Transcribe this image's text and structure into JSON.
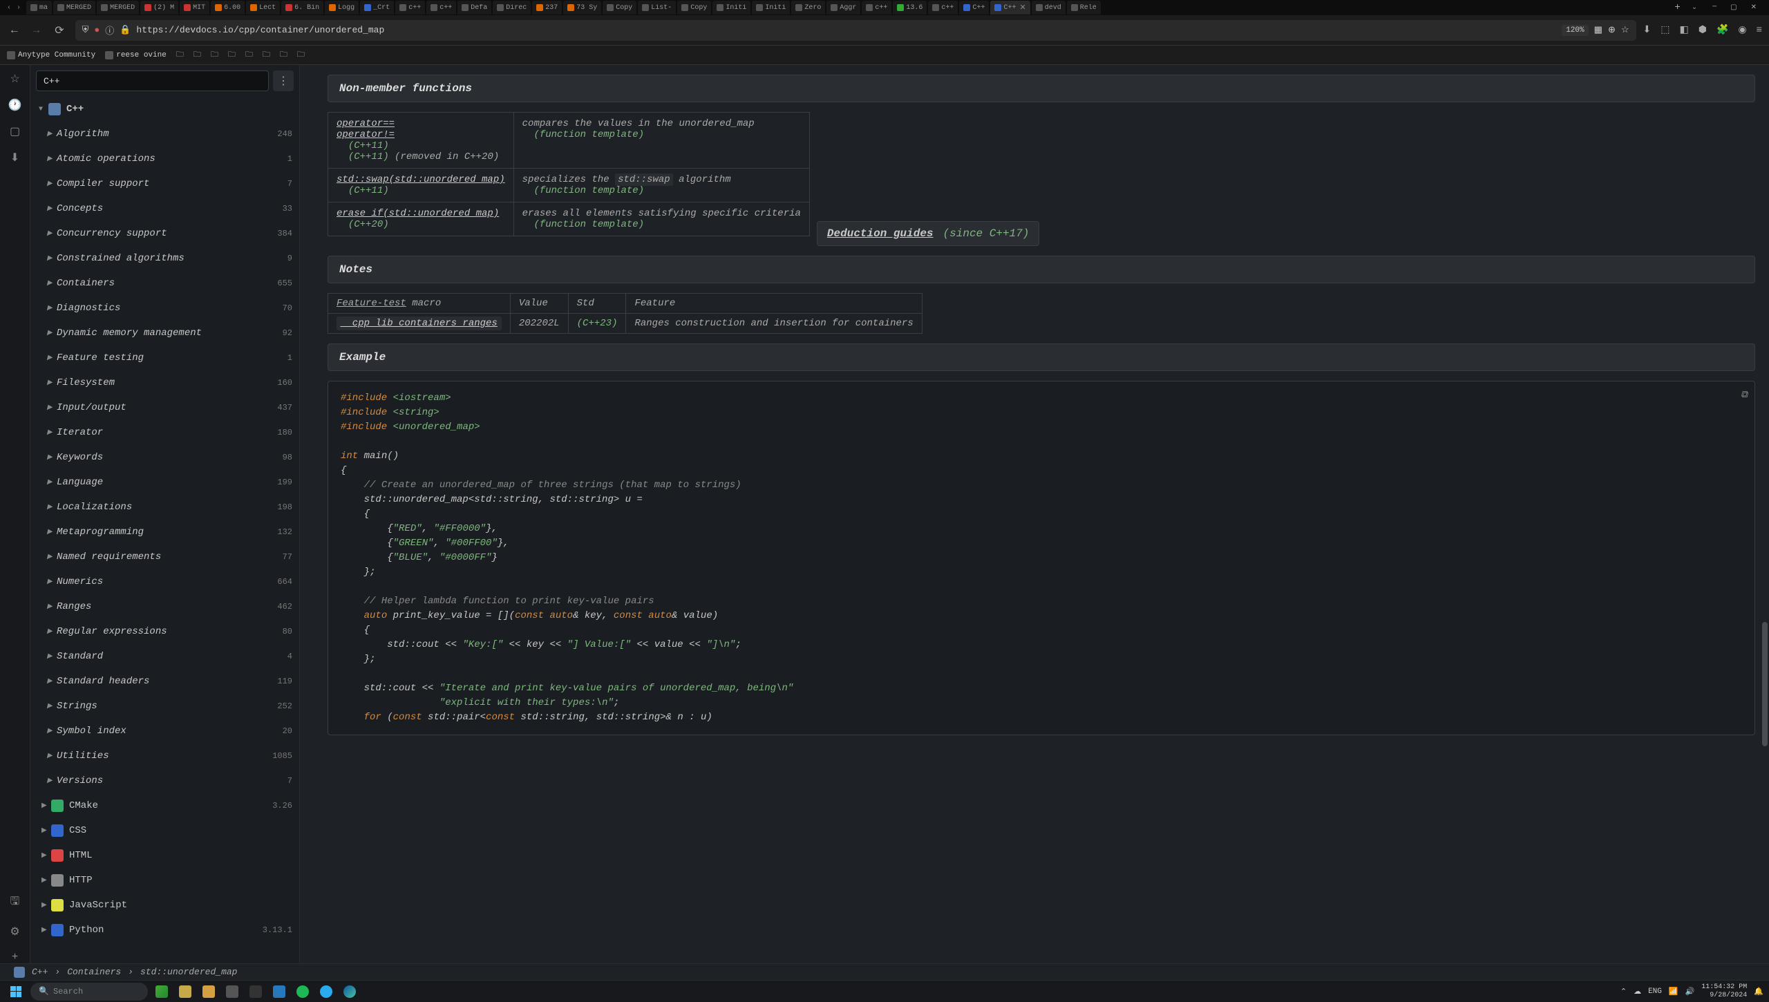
{
  "browser": {
    "tabs": [
      {
        "label": "ma",
        "icon": ""
      },
      {
        "label": "MERGED",
        "icon": ""
      },
      {
        "label": "MERGED",
        "icon": ""
      },
      {
        "label": "(2) M",
        "icon": "red"
      },
      {
        "label": "MIT",
        "icon": "red"
      },
      {
        "label": "6.00",
        "icon": "orange"
      },
      {
        "label": "Lect",
        "icon": "orange"
      },
      {
        "label": "6. Bin",
        "icon": "red"
      },
      {
        "label": "Logg",
        "icon": "orange"
      },
      {
        "label": "_Crt",
        "icon": "blue"
      },
      {
        "label": "c++",
        "icon": ""
      },
      {
        "label": "c++",
        "icon": ""
      },
      {
        "label": "Defa",
        "icon": ""
      },
      {
        "label": "Direc",
        "icon": ""
      },
      {
        "label": "237",
        "icon": "orange"
      },
      {
        "label": "73 Sy",
        "icon": "orange"
      },
      {
        "label": "Copy",
        "icon": ""
      },
      {
        "label": "List-",
        "icon": ""
      },
      {
        "label": "Copy",
        "icon": ""
      },
      {
        "label": "Initi",
        "icon": ""
      },
      {
        "label": "Initi",
        "icon": ""
      },
      {
        "label": "Zero",
        "icon": ""
      },
      {
        "label": "Aggr",
        "icon": ""
      },
      {
        "label": "c++",
        "icon": ""
      },
      {
        "label": "13.6",
        "icon": "green"
      },
      {
        "label": "c++",
        "icon": ""
      },
      {
        "label": "C++",
        "icon": "blue"
      },
      {
        "label": "C++",
        "icon": "blue",
        "active": true
      },
      {
        "label": "devd",
        "icon": ""
      },
      {
        "label": "Rele",
        "icon": ""
      }
    ],
    "url": "https://devdocs.io/cpp/container/unordered_map",
    "zoom": "120%",
    "bookmarks": [
      "Anytype Community",
      "reese ovine"
    ]
  },
  "sidebar": {
    "search_value": "C++",
    "root": "C++",
    "items": [
      {
        "label": "Algorithm",
        "count": "248"
      },
      {
        "label": "Atomic operations",
        "count": "1"
      },
      {
        "label": "Compiler support",
        "count": "7"
      },
      {
        "label": "Concepts",
        "count": "33"
      },
      {
        "label": "Concurrency support",
        "count": "384"
      },
      {
        "label": "Constrained algorithms",
        "count": "9"
      },
      {
        "label": "Containers",
        "count": "655"
      },
      {
        "label": "Diagnostics",
        "count": "70"
      },
      {
        "label": "Dynamic memory management",
        "count": "92"
      },
      {
        "label": "Feature testing",
        "count": "1"
      },
      {
        "label": "Filesystem",
        "count": "160"
      },
      {
        "label": "Input/output",
        "count": "437"
      },
      {
        "label": "Iterator",
        "count": "180"
      },
      {
        "label": "Keywords",
        "count": "98"
      },
      {
        "label": "Language",
        "count": "199"
      },
      {
        "label": "Localizations",
        "count": "198"
      },
      {
        "label": "Metaprogramming",
        "count": "132"
      },
      {
        "label": "Named requirements",
        "count": "77"
      },
      {
        "label": "Numerics",
        "count": "664"
      },
      {
        "label": "Ranges",
        "count": "462"
      },
      {
        "label": "Regular expressions",
        "count": "80"
      },
      {
        "label": "Standard",
        "count": "4"
      },
      {
        "label": "Standard headers",
        "count": "119"
      },
      {
        "label": "Strings",
        "count": "252"
      },
      {
        "label": "Symbol index",
        "count": "20"
      },
      {
        "label": "Utilities",
        "count": "1085"
      },
      {
        "label": "Versions",
        "count": "7"
      }
    ],
    "langs": [
      {
        "label": "CMake",
        "count": "3.26",
        "color": "#3a6"
      },
      {
        "label": "CSS",
        "count": "",
        "color": "#36c"
      },
      {
        "label": "HTML",
        "count": "",
        "color": "#d44"
      },
      {
        "label": "HTTP",
        "count": "",
        "color": "#888"
      },
      {
        "label": "JavaScript",
        "count": "",
        "color": "#dd4"
      },
      {
        "label": "Python",
        "count": "3.13.1",
        "color": "#36c"
      }
    ]
  },
  "content": {
    "nonmember_h": "Non-member functions",
    "funcs": [
      {
        "names": [
          "operator==",
          "operator!="
        ],
        "ver": "(C++11)",
        "removed": "(C++11) (removed in C++20)",
        "desc": "compares the values in the unordered_map",
        "tmpl": "(function template)"
      },
      {
        "names": [
          "std::swap(std::unordered_map)"
        ],
        "ver": "(C++11)",
        "desc_pre": "specializes the ",
        "desc_code": "std::swap",
        "desc_post": " algorithm",
        "tmpl": "(function template)"
      },
      {
        "names": [
          "erase_if(std::unordered_map)"
        ],
        "ver": "(C++20)",
        "desc": "erases all elements satisfying specific criteria",
        "tmpl": "(function template)"
      }
    ],
    "deduction": {
      "label": "Deduction guides",
      "since": "(since C++17)"
    },
    "notes_h": "Notes",
    "notes_cols": {
      "ft": "Feature-test",
      "macro": " macro",
      "value": "Value",
      "std": "Std",
      "feature": "Feature"
    },
    "notes_row": {
      "macro": "__cpp_lib_containers_ranges",
      "value": "202202L",
      "std": "(C++23)",
      "feature": "Ranges construction and insertion for containers"
    },
    "example_h": "Example"
  },
  "breadcrumb": [
    "C++",
    "Containers",
    "std::unordered_map"
  ],
  "taskbar": {
    "search_placeholder": "Search",
    "time": "11:54:32 PM",
    "date": "9/28/2024"
  }
}
